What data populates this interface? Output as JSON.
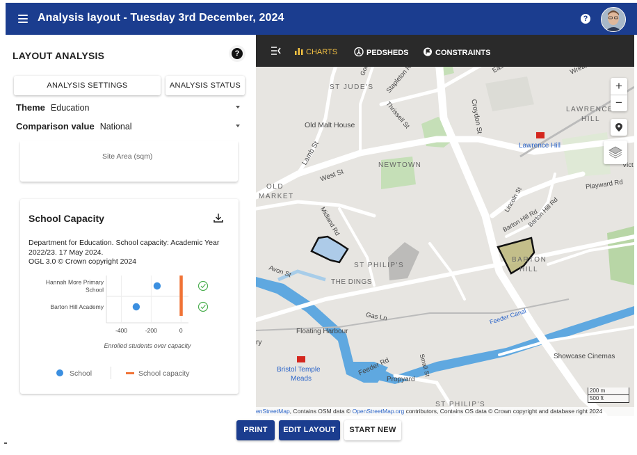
{
  "header": {
    "title": "Analysis layout - Tuesday 3rd December, 2024",
    "help_label": "?"
  },
  "left_panel": {
    "title": "LAYOUT ANALYSIS",
    "help_label": "?",
    "tabs": [
      {
        "label": "ANALYSIS SETTINGS"
      },
      {
        "label": "ANALYSIS STATUS"
      }
    ],
    "theme": {
      "label": "Theme",
      "value": "Education"
    },
    "comparison": {
      "label": "Comparison value",
      "value": "National"
    },
    "site_area_label": "Site Area (sqm)",
    "school_capacity": {
      "title": "School Capacity",
      "source": "Department for Education. School capacity: Academic Year 2022/23. 17 May 2024.",
      "copyright": "OGL 3.0 © Crown copyright 2024",
      "legend": [
        {
          "label": "School",
          "color": "#3b8fe0"
        },
        {
          "label": "School capacity",
          "color": "#f07336"
        }
      ]
    }
  },
  "chart_data": {
    "type": "scatter",
    "categories": [
      "Hannah More Primary School",
      "Barton Hill Academy"
    ],
    "category_lines": [
      [
        "Hannah More Primary",
        "School"
      ],
      [
        "Barton Hill Academy"
      ]
    ],
    "series": [
      {
        "name": "School",
        "values": [
          -160,
          -300
        ],
        "color": "#3b8fe0"
      },
      {
        "name": "School capacity",
        "values": [
          0,
          0
        ],
        "color": "#f07336"
      }
    ],
    "xlabel": "Enrolled students over capacity",
    "xlim": [
      -500,
      50
    ],
    "xticks": [
      "-400",
      "-200",
      "0"
    ],
    "xtick_values": [
      -400,
      -200,
      0
    ],
    "grid": true,
    "status_icons": [
      "check-circle-icon",
      "check-circle-icon"
    ],
    "status_color": "#4caf50"
  },
  "map": {
    "toolbar": [
      {
        "label": "CHARTS",
        "icon": "bar-chart-icon",
        "active": true,
        "color": "#f6c343"
      },
      {
        "label": "PEDSHEDS",
        "icon": "pedshed-icon",
        "active": false
      },
      {
        "label": "CONSTRAINTS",
        "icon": "constraints-icon",
        "active": false
      }
    ],
    "zoom_in": "+",
    "zoom_out": "−",
    "labels": {
      "st_judes": "ST JUDE'S",
      "old_malt_house": "Old Malt House",
      "lawrence_hill_area": "LAWRENCE",
      "lawrence_hill_area2": "HILL",
      "lawrence_hill_station": "Lawrence Hill",
      "newtown": "NEWTOWN",
      "old": "OLD",
      "market": "MARKET",
      "west_st": "West St",
      "lamb_st": "Lamb St",
      "croydon_st": "Croydon St",
      "thrissell_st": "Thrissell St",
      "stapleton_rd": "Stapleton Rd",
      "goodhind": "Goodhind",
      "easton_rd": "Easton Rd",
      "wrekhal": "Wreathal Rd",
      "playward": "Playward Rd",
      "vict": "Vict",
      "midland_rd": "Midland Rd",
      "lincoln_st": "Lincoln St",
      "barton_hill_rd": "Barton Hill Rd",
      "barton_hill_rd2": "Barton Hill Rd",
      "barton": "BARTON",
      "hill": "HILL",
      "st_philips": "ST PHILIP'S",
      "the_dings": "THE DINGS",
      "avon_st": "Avon St",
      "gas_ln": "Gas Ln",
      "feeder_canal": "Feeder Canal",
      "floating_harbour": "Floating Harbour",
      "feeder_rd": "Feeder Rd",
      "bristol_temple": "Bristol Temple",
      "meads": "Meads",
      "propyard": "Propyard",
      "small_st": "Small St",
      "showcase": "Showcase Cinemas",
      "st_philips2": "ST PHILIP'S",
      "ry": "ry"
    },
    "scale": [
      "200 m",
      "500 ft"
    ],
    "attribution": {
      "part1": "enStreetMap",
      "part2": ", Contains OSM data © ",
      "part3": "OpenStreetMap.org",
      "part4": " contributors, Contains OS data © Crown copyright and database right 2024"
    }
  },
  "footer": {
    "print": "PRINT",
    "edit_layout": "EDIT LAYOUT",
    "start_new": "START NEW"
  }
}
